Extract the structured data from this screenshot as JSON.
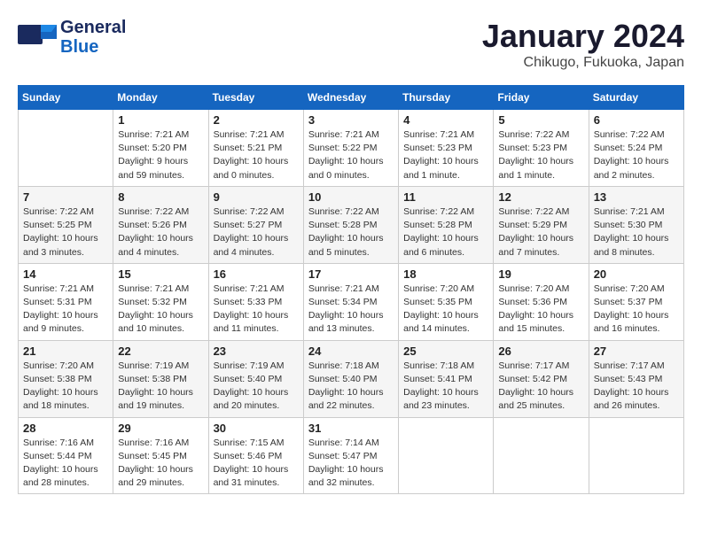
{
  "logo": {
    "line1": "General",
    "line2": "Blue"
  },
  "title": "January 2024",
  "subtitle": "Chikugo, Fukuoka, Japan",
  "headers": [
    "Sunday",
    "Monday",
    "Tuesday",
    "Wednesday",
    "Thursday",
    "Friday",
    "Saturday"
  ],
  "weeks": [
    [
      {
        "day": "",
        "info": ""
      },
      {
        "day": "1",
        "info": "Sunrise: 7:21 AM\nSunset: 5:20 PM\nDaylight: 9 hours\nand 59 minutes."
      },
      {
        "day": "2",
        "info": "Sunrise: 7:21 AM\nSunset: 5:21 PM\nDaylight: 10 hours\nand 0 minutes."
      },
      {
        "day": "3",
        "info": "Sunrise: 7:21 AM\nSunset: 5:22 PM\nDaylight: 10 hours\nand 0 minutes."
      },
      {
        "day": "4",
        "info": "Sunrise: 7:21 AM\nSunset: 5:23 PM\nDaylight: 10 hours\nand 1 minute."
      },
      {
        "day": "5",
        "info": "Sunrise: 7:22 AM\nSunset: 5:23 PM\nDaylight: 10 hours\nand 1 minute."
      },
      {
        "day": "6",
        "info": "Sunrise: 7:22 AM\nSunset: 5:24 PM\nDaylight: 10 hours\nand 2 minutes."
      }
    ],
    [
      {
        "day": "7",
        "info": "Sunrise: 7:22 AM\nSunset: 5:25 PM\nDaylight: 10 hours\nand 3 minutes."
      },
      {
        "day": "8",
        "info": "Sunrise: 7:22 AM\nSunset: 5:26 PM\nDaylight: 10 hours\nand 4 minutes."
      },
      {
        "day": "9",
        "info": "Sunrise: 7:22 AM\nSunset: 5:27 PM\nDaylight: 10 hours\nand 4 minutes."
      },
      {
        "day": "10",
        "info": "Sunrise: 7:22 AM\nSunset: 5:28 PM\nDaylight: 10 hours\nand 5 minutes."
      },
      {
        "day": "11",
        "info": "Sunrise: 7:22 AM\nSunset: 5:28 PM\nDaylight: 10 hours\nand 6 minutes."
      },
      {
        "day": "12",
        "info": "Sunrise: 7:22 AM\nSunset: 5:29 PM\nDaylight: 10 hours\nand 7 minutes."
      },
      {
        "day": "13",
        "info": "Sunrise: 7:21 AM\nSunset: 5:30 PM\nDaylight: 10 hours\nand 8 minutes."
      }
    ],
    [
      {
        "day": "14",
        "info": "Sunrise: 7:21 AM\nSunset: 5:31 PM\nDaylight: 10 hours\nand 9 minutes."
      },
      {
        "day": "15",
        "info": "Sunrise: 7:21 AM\nSunset: 5:32 PM\nDaylight: 10 hours\nand 10 minutes."
      },
      {
        "day": "16",
        "info": "Sunrise: 7:21 AM\nSunset: 5:33 PM\nDaylight: 10 hours\nand 11 minutes."
      },
      {
        "day": "17",
        "info": "Sunrise: 7:21 AM\nSunset: 5:34 PM\nDaylight: 10 hours\nand 13 minutes."
      },
      {
        "day": "18",
        "info": "Sunrise: 7:20 AM\nSunset: 5:35 PM\nDaylight: 10 hours\nand 14 minutes."
      },
      {
        "day": "19",
        "info": "Sunrise: 7:20 AM\nSunset: 5:36 PM\nDaylight: 10 hours\nand 15 minutes."
      },
      {
        "day": "20",
        "info": "Sunrise: 7:20 AM\nSunset: 5:37 PM\nDaylight: 10 hours\nand 16 minutes."
      }
    ],
    [
      {
        "day": "21",
        "info": "Sunrise: 7:20 AM\nSunset: 5:38 PM\nDaylight: 10 hours\nand 18 minutes."
      },
      {
        "day": "22",
        "info": "Sunrise: 7:19 AM\nSunset: 5:38 PM\nDaylight: 10 hours\nand 19 minutes."
      },
      {
        "day": "23",
        "info": "Sunrise: 7:19 AM\nSunset: 5:40 PM\nDaylight: 10 hours\nand 20 minutes."
      },
      {
        "day": "24",
        "info": "Sunrise: 7:18 AM\nSunset: 5:40 PM\nDaylight: 10 hours\nand 22 minutes."
      },
      {
        "day": "25",
        "info": "Sunrise: 7:18 AM\nSunset: 5:41 PM\nDaylight: 10 hours\nand 23 minutes."
      },
      {
        "day": "26",
        "info": "Sunrise: 7:17 AM\nSunset: 5:42 PM\nDaylight: 10 hours\nand 25 minutes."
      },
      {
        "day": "27",
        "info": "Sunrise: 7:17 AM\nSunset: 5:43 PM\nDaylight: 10 hours\nand 26 minutes."
      }
    ],
    [
      {
        "day": "28",
        "info": "Sunrise: 7:16 AM\nSunset: 5:44 PM\nDaylight: 10 hours\nand 28 minutes."
      },
      {
        "day": "29",
        "info": "Sunrise: 7:16 AM\nSunset: 5:45 PM\nDaylight: 10 hours\nand 29 minutes."
      },
      {
        "day": "30",
        "info": "Sunrise: 7:15 AM\nSunset: 5:46 PM\nDaylight: 10 hours\nand 31 minutes."
      },
      {
        "day": "31",
        "info": "Sunrise: 7:14 AM\nSunset: 5:47 PM\nDaylight: 10 hours\nand 32 minutes."
      },
      {
        "day": "",
        "info": ""
      },
      {
        "day": "",
        "info": ""
      },
      {
        "day": "",
        "info": ""
      }
    ]
  ]
}
